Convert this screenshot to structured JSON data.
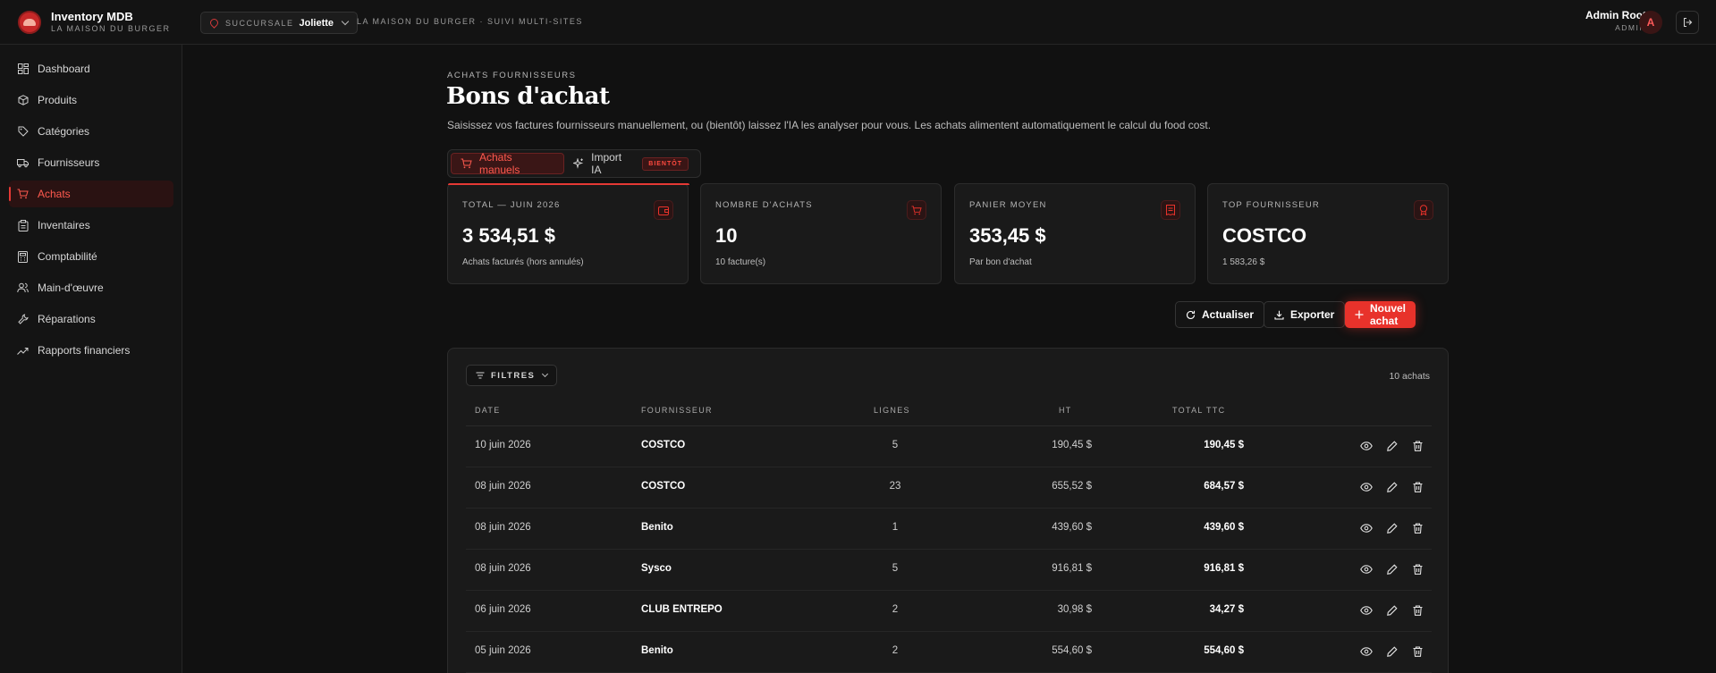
{
  "header": {
    "app_title": "Inventory MDB",
    "app_subtitle": "LA MAISON DU BURGER",
    "branch_label": "SUCCURSALE",
    "branch_value": "Joliette",
    "tagline": "LA MAISON DU BURGER · SUIVI MULTI-SITES",
    "user_name": "Admin Root",
    "user_role": "ADMIN",
    "avatar_initial": "A"
  },
  "sidebar": {
    "items": [
      {
        "label": "Dashboard",
        "icon": "dashboard-icon"
      },
      {
        "label": "Produits",
        "icon": "box-icon"
      },
      {
        "label": "Catégories",
        "icon": "tag-icon"
      },
      {
        "label": "Fournisseurs",
        "icon": "truck-icon"
      },
      {
        "label": "Achats",
        "icon": "cart-icon",
        "active": true
      },
      {
        "label": "Inventaires",
        "icon": "clipboard-icon"
      },
      {
        "label": "Comptabilité",
        "icon": "calculator-icon"
      },
      {
        "label": "Main-d'œuvre",
        "icon": "users-icon"
      },
      {
        "label": "Réparations",
        "icon": "wrench-icon"
      },
      {
        "label": "Rapports financiers",
        "icon": "trend-icon"
      }
    ]
  },
  "page": {
    "eyebrow": "ACHATS FOURNISSEURS",
    "title": "Bons d'achat",
    "description": "Saisissez vos factures fournisseurs manuellement, ou (bientôt) laissez l'IA les analyser pour vous. Les achats alimentent automatiquement le calcul du food cost."
  },
  "tabs": {
    "manual": "Achats manuels",
    "ai": "Import IA",
    "soon_badge": "BIENTÔT"
  },
  "stats": [
    {
      "label": "TOTAL — JUIN 2026",
      "value": "3 534,51 $",
      "sub": "Achats facturés (hors annulés)",
      "icon": "wallet-icon"
    },
    {
      "label": "NOMBRE D'ACHATS",
      "value": "10",
      "sub": "10 facture(s)",
      "icon": "cart-icon"
    },
    {
      "label": "PANIER MOYEN",
      "value": "353,45 $",
      "sub": "Par bon d'achat",
      "icon": "receipt-icon"
    },
    {
      "label": "TOP FOURNISSEUR",
      "value": "COSTCO",
      "sub": "1 583,26 $",
      "icon": "award-icon"
    }
  ],
  "actions": {
    "refresh": "Actualiser",
    "export": "Exporter",
    "new": "Nouvel achat"
  },
  "table": {
    "filters_label": "FILTRES",
    "count": "10 achats",
    "headers": {
      "date": "DATE",
      "supplier": "FOURNISSEUR",
      "lines": "LIGNES",
      "ht": "HT",
      "ttc": "TOTAL TTC"
    },
    "rows": [
      {
        "date": "10 juin 2026",
        "supplier": "COSTCO",
        "lines": "5",
        "ht": "190,45 $",
        "ttc": "190,45 $"
      },
      {
        "date": "08 juin 2026",
        "supplier": "COSTCO",
        "lines": "23",
        "ht": "655,52 $",
        "ttc": "684,57 $"
      },
      {
        "date": "08 juin 2026",
        "supplier": "Benito",
        "lines": "1",
        "ht": "439,60 $",
        "ttc": "439,60 $"
      },
      {
        "date": "08 juin 2026",
        "supplier": "Sysco",
        "lines": "5",
        "ht": "916,81 $",
        "ttc": "916,81 $"
      },
      {
        "date": "06 juin 2026",
        "supplier": "CLUB ENTREPO",
        "lines": "2",
        "ht": "30,98 $",
        "ttc": "34,27 $"
      },
      {
        "date": "05 juin 2026",
        "supplier": "Benito",
        "lines": "2",
        "ht": "554,60 $",
        "ttc": "554,60 $"
      }
    ]
  },
  "colors": {
    "accent": "#e8322b",
    "background": "#111111",
    "card": "#1a1a1a"
  }
}
